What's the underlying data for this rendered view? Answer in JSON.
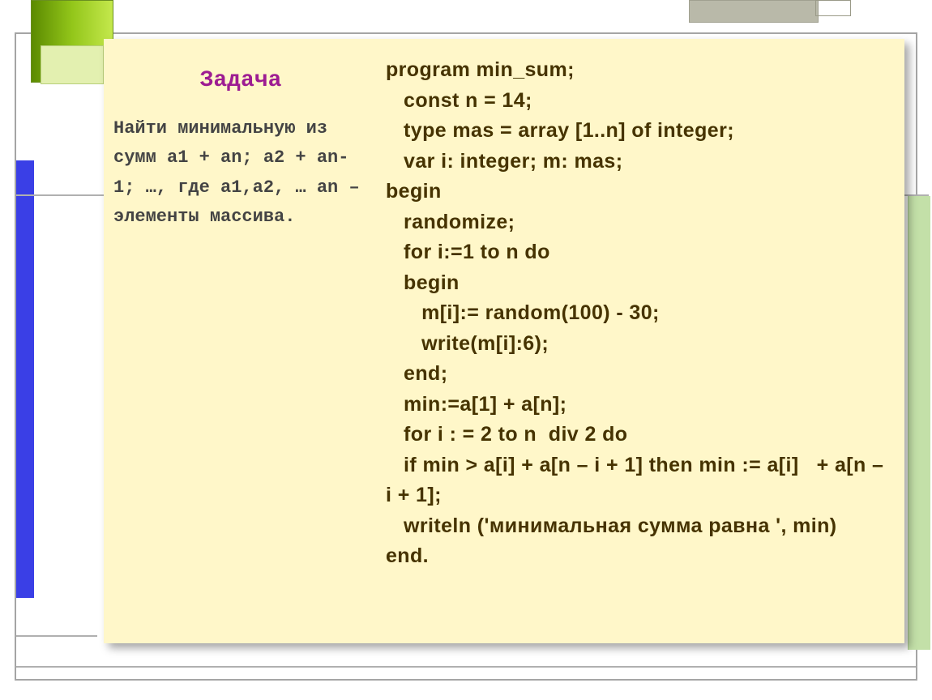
{
  "title": "Задача",
  "task_text": "Найти минимальную из сумм\na1 + an; a2 + an-1;\n…, где a1,a2, … an – элементы массива.",
  "code": "program min_sum;\n   const n = 14;\n   type mas = array [1..n] of integer;\n   var i: integer; m: mas;\nbegin\n   randomize;\n   for i:=1 to n do\n   begin\n      m[i]:= random(100) - 30;\n      write(m[i]:6);\n   end;\n   min:=a[1] + a[n];\n   for i : = 2 to n  div 2 do\n   if min > a[i] + a[n – i + 1] then min := a[i]   + a[n – i + 1];\n   writeln ('минимальная сумма равна ', min)\nend."
}
